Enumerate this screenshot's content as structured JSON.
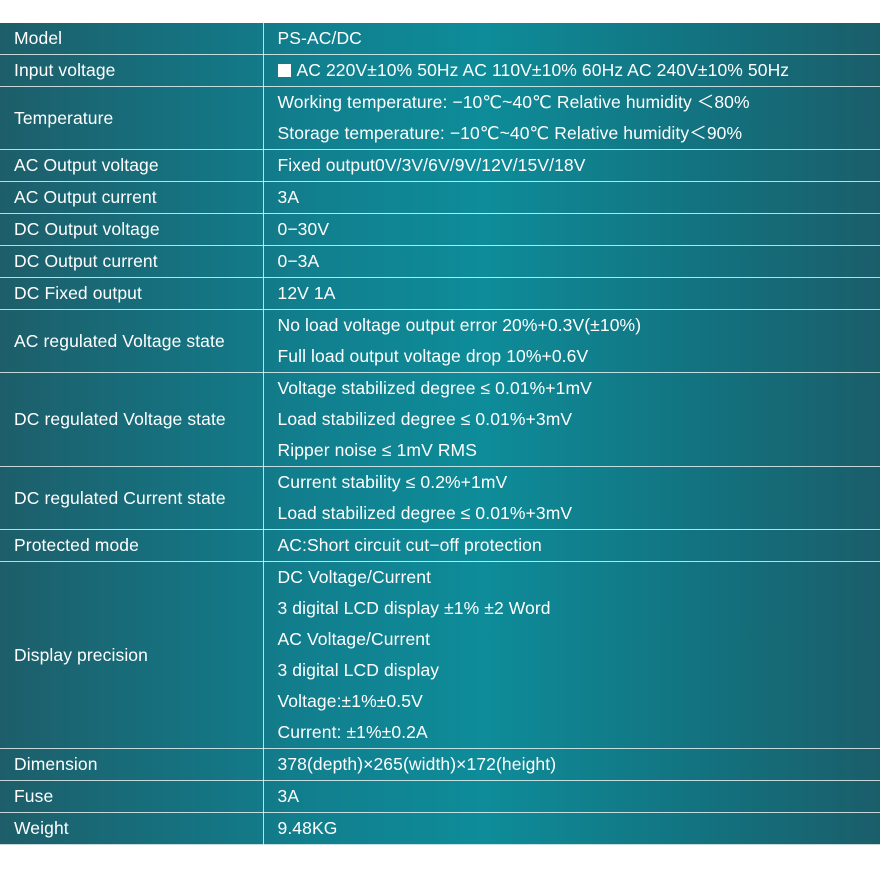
{
  "rows": [
    {
      "label": "Model",
      "values": [
        "PS-AC/DC"
      ]
    },
    {
      "label": "Input voltage",
      "checkbox_icon": "checkbox-square-icon",
      "values": [
        "AC 220V±10% 50Hz AC 110V±10% 60Hz AC 240V±10% 50Hz"
      ]
    },
    {
      "label": "Temperature",
      "values": [
        "Working temperature: −10℃~40℃ Relative humidity ＜80%",
        "Storage temperature: −10℃~40℃ Relative humidity＜90%"
      ]
    },
    {
      "label": "AC Output voltage",
      "values": [
        "Fixed output0V/3V/6V/9V/12V/15V/18V"
      ]
    },
    {
      "label": "AC Output current",
      "values": [
        "3A"
      ]
    },
    {
      "label": "DC Output voltage",
      "values": [
        "0−30V"
      ]
    },
    {
      "label": "DC Output current",
      "values": [
        "0−3A"
      ]
    },
    {
      "label": "DC Fixed output",
      "values": [
        "12V 1A"
      ]
    },
    {
      "label": "AC regulated Voltage state",
      "values": [
        "No load voltage output error 20%+0.3V(±10%)",
        "Full load output voltage drop 10%+0.6V"
      ]
    },
    {
      "label": "DC regulated Voltage state",
      "values": [
        "Voltage stabilized degree ≤ 0.01%+1mV",
        "Load stabilized degree ≤ 0.01%+3mV",
        "Ripper noise ≤ 1mV RMS"
      ]
    },
    {
      "label": "DC regulated Current state",
      "values": [
        "Current stability ≤ 0.2%+1mV",
        "Load stabilized degree ≤ 0.01%+3mV"
      ]
    },
    {
      "label": "Protected mode",
      "values": [
        "AC:Short circuit cut−off protection"
      ]
    },
    {
      "label": "Display precision",
      "values": [
        "DC Voltage/Current",
        "3 digital LCD display ±1% ±2 Word",
        "AC Voltage/Current",
        "3 digital LCD display",
        "Voltage:±1%±0.5V",
        "Current: ±1%±0.2A"
      ]
    },
    {
      "label": "Dimension",
      "values": [
        "378(depth)×265(width)×172(height)"
      ]
    },
    {
      "label": "Fuse",
      "values": [
        "3A"
      ]
    },
    {
      "label": "Weight",
      "values": [
        "9.48KG"
      ]
    }
  ]
}
